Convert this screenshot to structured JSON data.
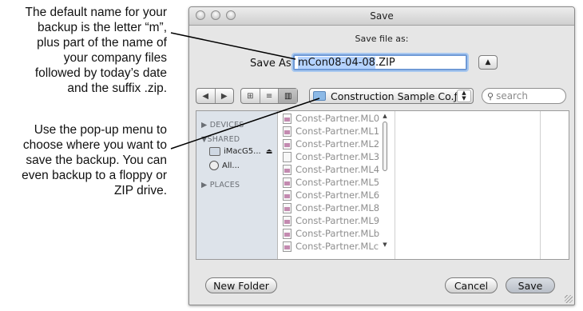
{
  "callouts": [
    {
      "lines": [
        "The default name for your",
        "backup is the letter “m”,",
        "plus part of the name of",
        "your company files",
        "followed by today’s date",
        "and the suffix .zip."
      ]
    },
    {
      "lines": [
        "Use the pop-up menu to",
        "choose where you want to",
        "save the backup. You can",
        "even backup to a floppy or",
        "ZIP drive."
      ]
    }
  ],
  "window": {
    "title": "Save"
  },
  "dialog": {
    "save_file_as": "Save file as:",
    "save_as_label": "Save As:",
    "filename_selected": "mCon08-04-08",
    "filename_ext": ".ZIP"
  },
  "toolbar": {
    "location": "Construction Sample Co.ƒ",
    "search_placeholder": "search"
  },
  "sidebar": {
    "devices": "DEVICES",
    "shared": "SHARED",
    "shared_items": [
      "iMacG5...",
      "All..."
    ],
    "places": "PLACES"
  },
  "files": [
    {
      "name": "Const-Partner.ML0",
      "icon": "document-icon"
    },
    {
      "name": "Const-Partner.ML1",
      "icon": "document-icon"
    },
    {
      "name": "Const-Partner.ML2",
      "icon": "document-icon"
    },
    {
      "name": "Const-Partner.ML3",
      "icon": "blank-file-icon"
    },
    {
      "name": "Const-Partner.ML4",
      "icon": "document-icon"
    },
    {
      "name": "Const-Partner.ML5",
      "icon": "document-icon"
    },
    {
      "name": "Const-Partner.ML6",
      "icon": "document-icon"
    },
    {
      "name": "Const-Partner.ML8",
      "icon": "document-icon"
    },
    {
      "name": "Const-Partner.ML9",
      "icon": "document-icon"
    },
    {
      "name": "Const-Partner.MLb",
      "icon": "document-icon"
    },
    {
      "name": "Const-Partner.MLc",
      "icon": "document-icon"
    }
  ],
  "buttons": {
    "new_folder": "New Folder",
    "cancel": "Cancel",
    "save": "Save"
  }
}
